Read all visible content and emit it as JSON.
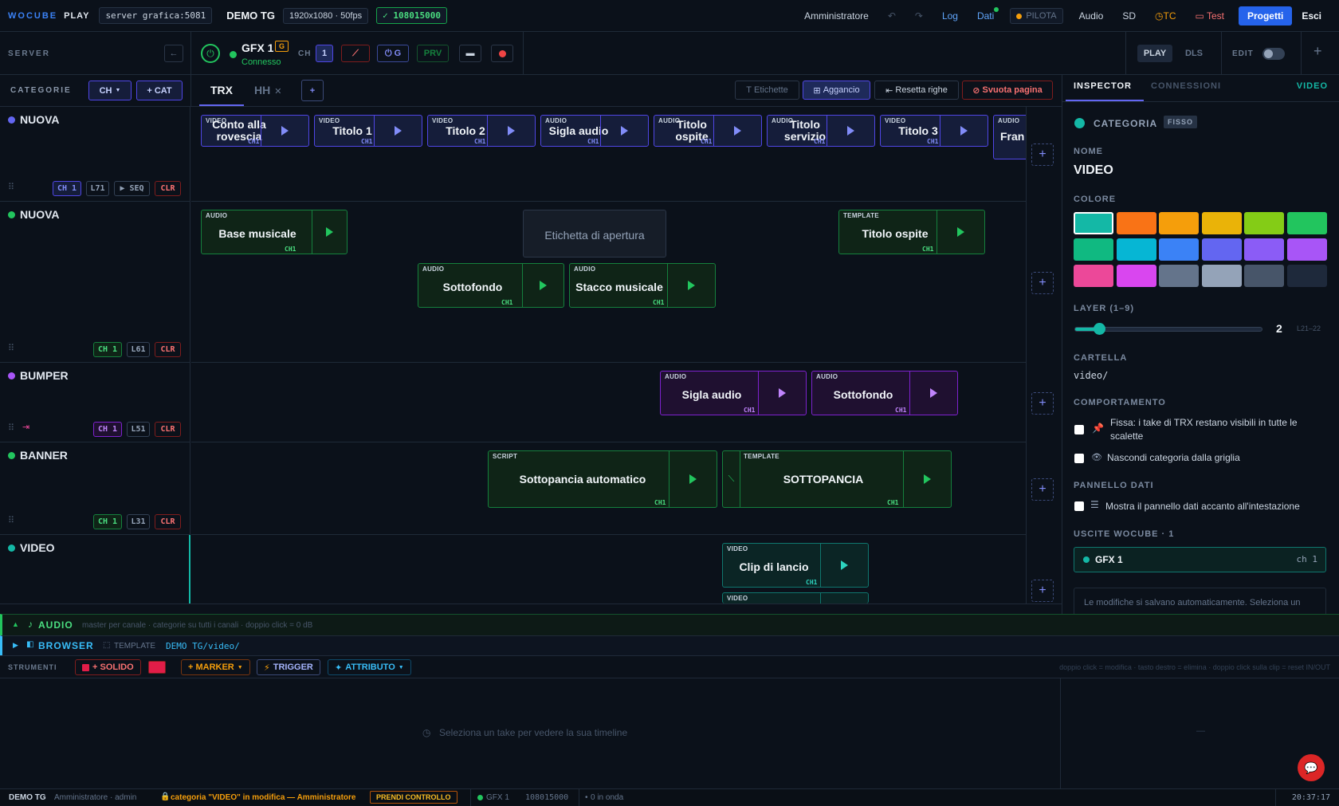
{
  "top": {
    "brand": "WOCUBE",
    "brand2": "PLAY",
    "server": "server grafica:5081",
    "project": "DEMO TG",
    "resolution": "1920x1080 · 50fps",
    "status_code": "✓ 108015000",
    "user": "Amministratore",
    "log": "Log",
    "dati": "Dati",
    "pilota": "PILOTA",
    "audio": "Audio",
    "sd": "SD",
    "tc": "TC",
    "test": "Test",
    "progetti": "Progetti",
    "esci": "Esci"
  },
  "server_bar": {
    "label": "SERVER",
    "back": "←",
    "gfx": "GFX 1",
    "gfx_badge": "G",
    "connected": "Connesso",
    "ch_label": "CH",
    "ch_value": "1",
    "g_btn": "G",
    "prv": "PRV",
    "play": "PLAY",
    "dls": "DLS",
    "edit": "EDIT",
    "plus": "+"
  },
  "cat_header": {
    "label": "CATEGORIE",
    "ch_btn": "CH",
    "add_cat": "+ CAT",
    "tab_trx": "TRX",
    "tab_hh": "HH",
    "tab_plus": "+",
    "etichette": "Etichette",
    "aggancio": "Aggancio",
    "resetta": "Resetta righe",
    "svuota": "Svuota pagina"
  },
  "categories": [
    {
      "name": "NUOVA",
      "color": "#6366f1",
      "tags": [
        "CH 1",
        "L71",
        "▶ SEQ",
        "CLR"
      ]
    },
    {
      "name": "NUOVA",
      "color": "#22c55e",
      "tags": [
        "CH 1",
        "L61",
        "CLR"
      ]
    },
    {
      "name": "BUMPER",
      "color": "#a855f7",
      "tags": [
        "CH 1",
        "L51",
        "CLR"
      ]
    },
    {
      "name": "BANNER",
      "color": "#22c55e",
      "tags": [
        "CH 1",
        "L31",
        "CLR"
      ]
    },
    {
      "name": "VIDEO",
      "color": "#14b8a6",
      "tags": []
    }
  ],
  "clips_row1": [
    {
      "type": "VIDEO",
      "title": "Conto alla rovescia",
      "ch": "CH1"
    },
    {
      "type": "VIDEO",
      "title": "Titolo 1",
      "ch": "CH1"
    },
    {
      "type": "VIDEO",
      "title": "Titolo 2",
      "ch": "CH1"
    },
    {
      "type": "AUDIO",
      "title": "Sigla audio",
      "ch": "CH1"
    },
    {
      "type": "AUDIO",
      "title": "Titolo ospite",
      "ch": "CH1"
    },
    {
      "type": "AUDIO",
      "title": "Titolo servizio",
      "ch": "CH1"
    },
    {
      "type": "VIDEO",
      "title": "Titolo 3",
      "ch": "CH1"
    },
    {
      "type": "AUDIO",
      "title": "Fran - E",
      "ch": ""
    }
  ],
  "clips_row2": [
    {
      "type": "AUDIO",
      "title": "Base musicale",
      "ch": "CH1"
    },
    {
      "type": "",
      "title": "Etichetta di apertura",
      "ch": ""
    },
    {
      "type": "TEMPLATE",
      "title": "Titolo ospite",
      "ch": "CH1"
    },
    {
      "type": "AUDIO",
      "title": "Sottofondo",
      "ch": "CH1"
    },
    {
      "type": "AUDIO",
      "title": "Stacco musicale",
      "ch": "CH1"
    }
  ],
  "clips_row3": [
    {
      "type": "AUDIO",
      "title": "Sigla audio",
      "ch": "CH1"
    },
    {
      "type": "AUDIO",
      "title": "Sottofondo",
      "ch": "CH1"
    }
  ],
  "clips_row4": [
    {
      "type": "SCRIPT",
      "title": "Sottopancia automatico",
      "ch": "CH1"
    },
    {
      "type": "TEMPLATE",
      "title": "SOTTOPANCIA",
      "ch": "CH1"
    }
  ],
  "clips_row5": [
    {
      "type": "VIDEO",
      "title": "Clip di lancio",
      "ch": "CH1"
    },
    {
      "type": "VIDEO",
      "title": "",
      "ch": ""
    }
  ],
  "inspector": {
    "tab1": "INSPECTOR",
    "tab2": "CONNESSIONI",
    "tab3": "VIDEO",
    "categoria": "CATEGORIA",
    "fisso": "FISSO",
    "nome_lbl": "NOME",
    "nome": "VIDEO",
    "colore_lbl": "COLORE",
    "colors": [
      "#14b8a6",
      "#f97316",
      "#f59e0b",
      "#eab308",
      "#84cc16",
      "#22c55e",
      "#10b981",
      "#06b6d4",
      "#3b82f6",
      "#6366f1",
      "#8b5cf6",
      "#a855f7",
      "#ec4899",
      "#d946ef",
      "#64748b",
      "#94a3b8",
      "#475569",
      "#1e293b"
    ],
    "layer_lbl": "LAYER (1–9)",
    "layer_val": "2",
    "layer_frac": 0.125,
    "layer_range": "L21–22",
    "cartella_lbl": "CARTELLA",
    "cartella": "video/",
    "comport_lbl": "COMPORTAMENTO",
    "fissa": "Fissa: i take di TRX restano visibili in tutte le scalette",
    "nascondi": "Nascondi categoria dalla griglia",
    "pannello_lbl": "PANNELLO DATI",
    "mostra": "Mostra il pannello dati accanto all'intestazione",
    "uscite_lbl": "USCITE WOCUBE · 1",
    "out_name": "GFX 1",
    "out_ch": "ch 1",
    "note": "Le modifiche si salvano automaticamente. Seleziona un"
  },
  "audio_bar": {
    "label": "AUDIO",
    "desc": "master per canale · categorie su tutti i canali · doppio click = 0 dB"
  },
  "browser_bar": {
    "label": "BROWSER",
    "template": "TEMPLATE",
    "path": "DEMO TG/video/"
  },
  "tools": {
    "label": "STRUMENTI",
    "solido": "+ SOLIDO",
    "marker": "+ MARKER",
    "trigger": "TRIGGER",
    "attributo": "ATTRIBUTO",
    "hint": "doppio click = modifica · tasto destro = elimina · doppio click sulla clip = reset IN/OUT"
  },
  "timeline": {
    "empty": "Seleziona un take per vedere la sua timeline",
    "dash": "—"
  },
  "status": {
    "project": "DEMO TG",
    "user": "Amministratore · admin",
    "lock": "categoria \"VIDEO\" in modifica — Amministratore",
    "prendi": "PRENDI CONTROLLO",
    "gfx": "GFX 1",
    "code": "108015000",
    "onair": "0 in onda",
    "time": "20:37:17"
  }
}
